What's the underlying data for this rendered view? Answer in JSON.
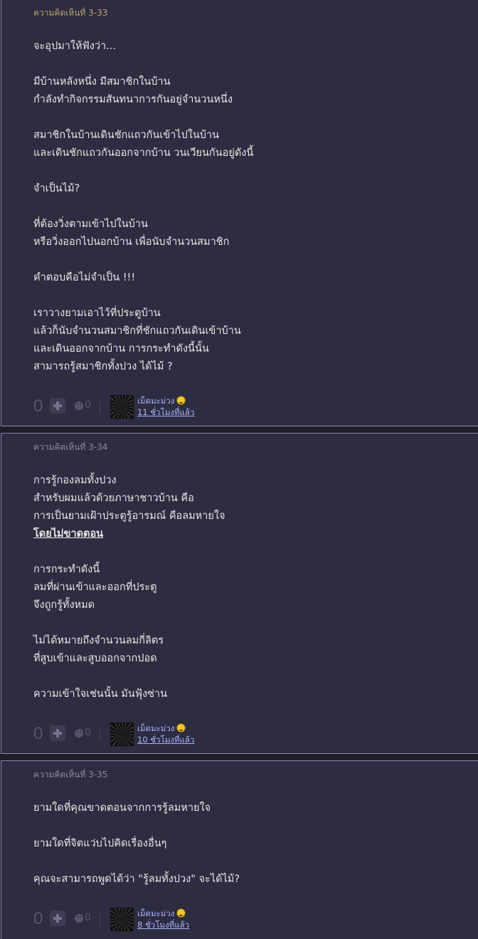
{
  "comments": [
    {
      "header": "ความคิดเห็นที่ 3-33",
      "lines": [
        "จะอุปมาให้ฟังว่า...",
        "",
        "มีบ้านหลังหนึ่ง มีสมาชิกในบ้าน",
        "กำลังทำกิจกรรมสันทนาการกันอยู่จำนวนหนึ่ง",
        "",
        "สมาชิกในบ้านเดินชักแถวกันเข้าไปในบ้าน",
        "และเดินชักแถวกันออกจากบ้าน วนเวียนกันอยู่ดังนี้",
        "",
        "จำเป็นไม้?",
        "",
        "ที่ต้องวิ่งตามเข้าไปในบ้าน",
        "หรือวิ่งออกไปนอกบ้าน เพื่อนับจำนวนสมาชิก",
        "",
        "คำตอบคือไม่จำเป็น !!!",
        "",
        "เราวางยามเอาไว้ที่ประตูบ้าน",
        "แล้วก็นับจำนวนสมาชิกที่ชักแถวกันเดินเข้าบ้าน",
        "และเดินออกจากบ้าน การกระทำดังนี้นั้น",
        "สามารถรู้สมาชิกทั้งปวง ได้ไม้ ?"
      ],
      "score": "0",
      "emo_count": "0",
      "user": "เม็ดมะม่วง",
      "time": "11 ชั่วโมงที่แล้ว"
    },
    {
      "header": "ความคิดเห็นที่ 3-34",
      "lines": [
        "การรู้กองลมทั้งปวง",
        "สำหรับผมแล้วด้วยภาษาชาวบ้าน คือ",
        "การเป็นยามเฝ้าประตูรู้อารมณ์ คือลมหายใจ",
        "โดยไม่ขาดตอน",
        "",
        "การกระทำดังนี้",
        "ลมที่ผ่านเข้าและออกที่ประตู",
        "จึงถูกรู้ทั้งหมด",
        "",
        "ไม่ได้หมายถึงจำนวนลมกี่ลิตร",
        "ที่สูบเข้าและสูบออกจากปอด",
        "",
        "ความเข้าใจเช่นนั้น มันฟุ้งซ่าน"
      ],
      "score": "0",
      "emo_count": "0",
      "user": "เม็ดมะม่วง",
      "time": "10 ชั่วโมงที่แล้ว"
    },
    {
      "header": "ความคิดเห็นที่ 3-35",
      "lines": [
        "ยามใดที่คุณขาดตอนจากการรู้ลมหายใจ",
        "",
        "ยามใดที่จิตแว่บไปคิดเรื่องอื่นๆ",
        "",
        "คุณจะสามารถพูดได้ว่า \"รู้ลมทั้งปวง\" จะได้ไม้?"
      ],
      "score": "0",
      "emo_count": "0",
      "user": "เม็ดมะม่วง",
      "time": "8 ชั่วโมงที่แล้ว"
    }
  ]
}
